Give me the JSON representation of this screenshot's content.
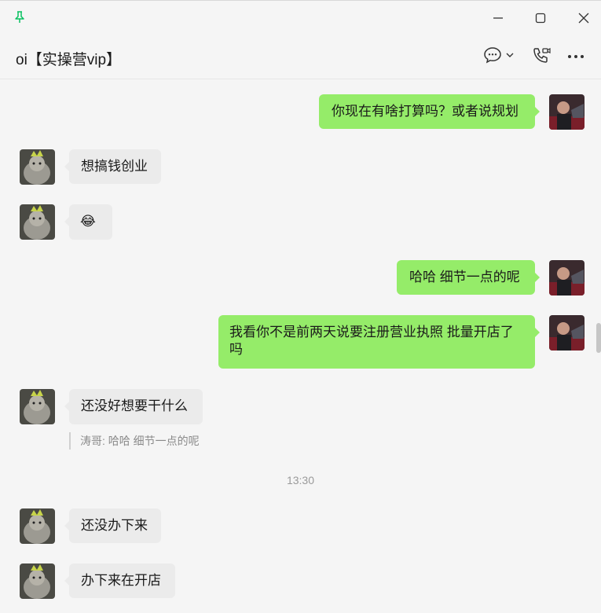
{
  "header": {
    "title": "oi【实操营vip】"
  },
  "icons": {
    "pin": "pin-icon",
    "minimize": "minimize-icon",
    "maximize": "maximize-icon",
    "close": "close-icon",
    "chat": "chat-bubble-icon",
    "dropdown": "chevron-down-icon",
    "call": "phone-video-icon",
    "more": "more-icon"
  },
  "colors": {
    "outgoing": "#95ec69",
    "incoming": "#ebebeb",
    "accent": "#07c160"
  },
  "messages": [
    {
      "side": "out",
      "text": "你现在有啥打算吗？或者说规划"
    },
    {
      "side": "in",
      "text": "想搞钱创业"
    },
    {
      "side": "in",
      "text": "😂"
    },
    {
      "side": "out",
      "text": "哈哈 细节一点的呢"
    },
    {
      "side": "out",
      "text": "我看你不是前两天说要注册营业执照 批量开店了吗"
    },
    {
      "side": "in",
      "text": "还没好想要干什么"
    },
    {
      "side": "in",
      "text": "还没办下来"
    },
    {
      "side": "in",
      "text": "办下来在开店"
    }
  ],
  "quote": {
    "text": "涛哥: 哈哈 细节一点的呢"
  },
  "timestamp": "13:30"
}
